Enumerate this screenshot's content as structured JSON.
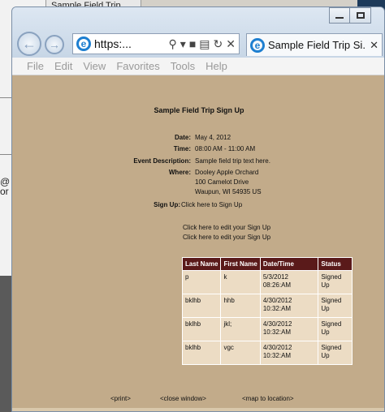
{
  "background": {
    "tab_label": "Sample Field Trip",
    "side_chars": [
      "@",
      "or"
    ]
  },
  "browser": {
    "address": {
      "url": "https:..."
    },
    "tab": {
      "title": "Sample Field Trip Si..."
    },
    "menu": [
      "File",
      "Edit",
      "View",
      "Favorites",
      "Tools",
      "Help"
    ]
  },
  "page": {
    "title": "Sample Field Trip Sign Up",
    "fields": {
      "date_label": "Date:",
      "date_value": "May 4, 2012",
      "time_label": "Time:",
      "time_value": "08:00 AM - 11:00 AM",
      "desc_label": "Event Description:",
      "desc_value": "Sample field trip text here.",
      "where_label": "Where:",
      "where_line1": "Dooley Apple Orchard",
      "where_line2": "100 Camelot Drive",
      "where_line3": "Waupun, WI 54935 US"
    },
    "signup_label": "Sign Up:",
    "signup_link": "Click here to Sign Up",
    "edit_links": [
      "Click here to edit your Sign Up",
      "Click here to edit your Sign Up"
    ],
    "table": {
      "headers": [
        "Last Name",
        "First Name",
        "Date/Time",
        "Status"
      ],
      "rows": [
        [
          "p",
          "k",
          "5/3/2012 08:26:AM",
          "Signed Up"
        ],
        [
          "bklhb",
          "hhb",
          "4/30/2012 10:32:AM",
          "Signed Up"
        ],
        [
          "bklhb",
          "jkl;",
          "4/30/2012 10:32:AM",
          "Signed Up"
        ],
        [
          "bklhb",
          "vgc",
          "4/30/2012 10:32:AM",
          "Signed Up"
        ]
      ]
    },
    "footer": {
      "print": "<print>",
      "close": "<close window>",
      "map": "<map to location>"
    }
  },
  "colors": {
    "page_bg": "#c2ab8a",
    "table_header_bg": "#5a1a1a",
    "table_cell_bg": "#ecdcc4"
  }
}
